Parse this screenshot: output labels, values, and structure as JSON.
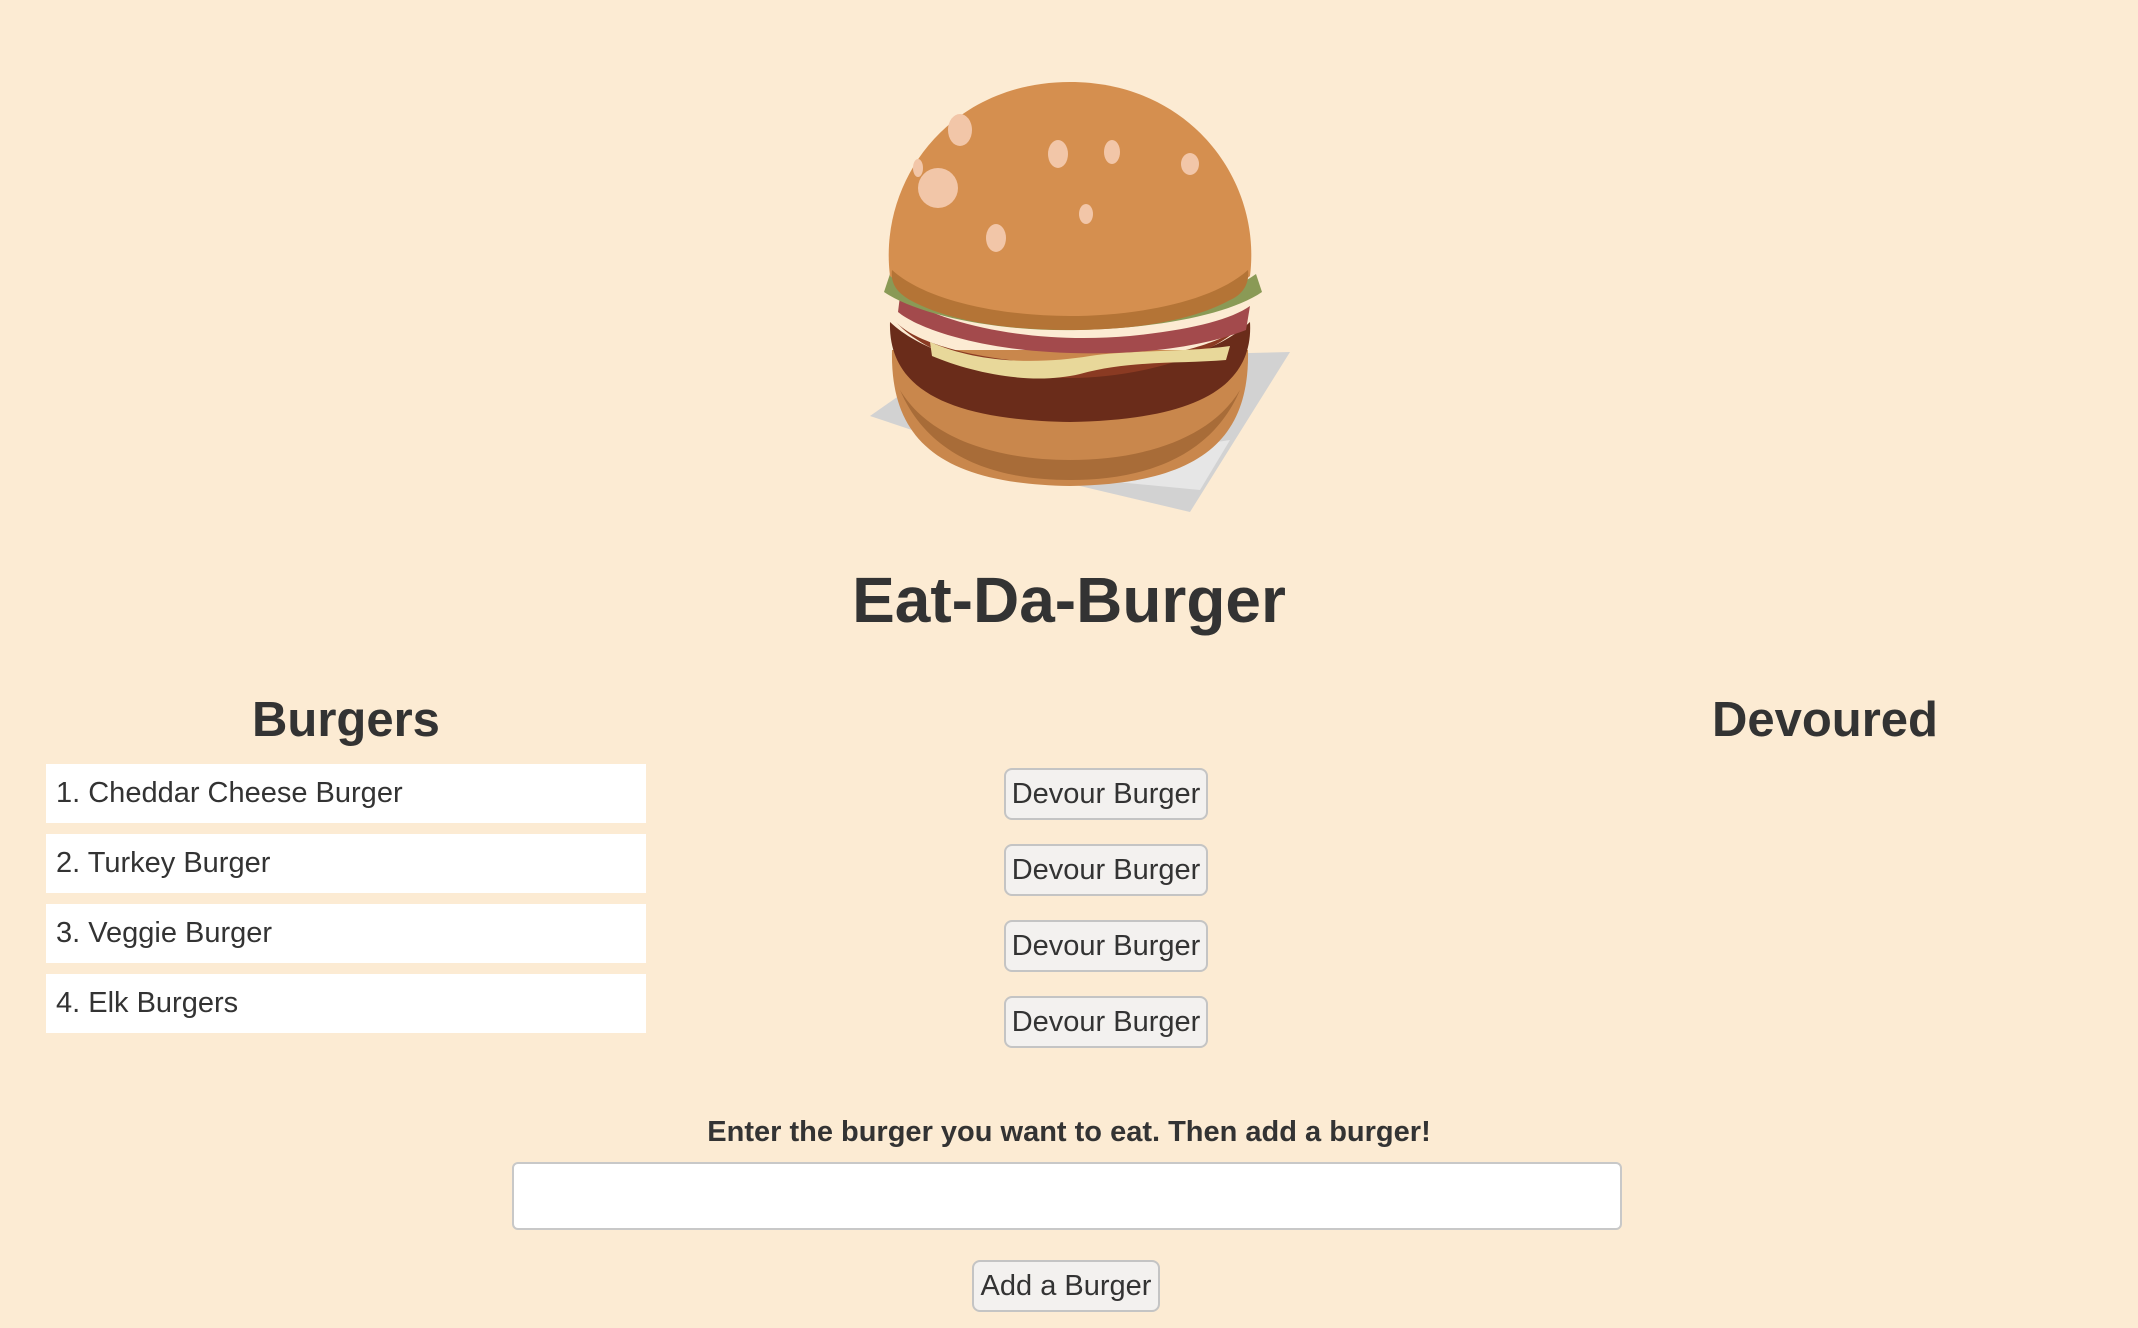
{
  "header": {
    "logo_icon": "burger-icon",
    "title": "Eat-Da-Burger"
  },
  "burgers": {
    "heading": "Burgers",
    "items": [
      "1. Cheddar Cheese Burger",
      "2. Turkey Burger",
      "3. Veggie Burger",
      "4. Elk Burgers"
    ],
    "devour_label": "Devour Burger"
  },
  "devoured": {
    "heading": "Devoured",
    "items": []
  },
  "form": {
    "label": "Enter the burger you want to eat. Then add a burger!",
    "input_value": "",
    "input_placeholder": "",
    "submit_label": "Add a Burger"
  },
  "colors": {
    "background": "#fcebd3",
    "text": "#333333",
    "list_item_bg": "#ffffff",
    "button_bg": "#f3f1ef"
  }
}
